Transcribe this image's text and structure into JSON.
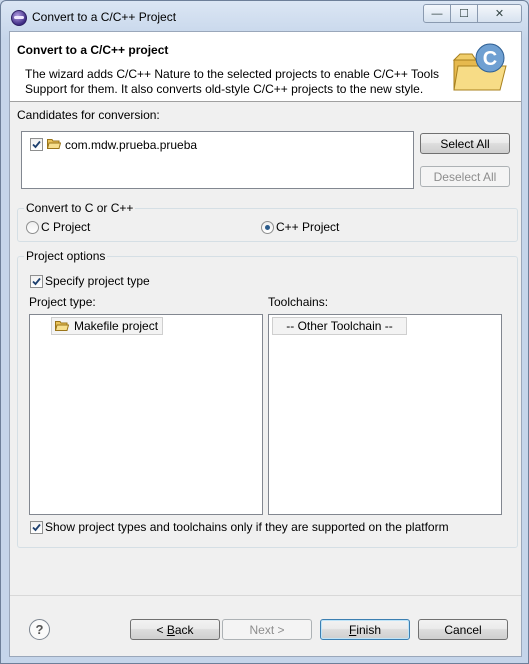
{
  "window": {
    "title": "Convert to a C/C++ Project",
    "controls": {
      "minimize": "—",
      "maximize": "☐",
      "close": "✕"
    }
  },
  "header": {
    "title": "Convert to a C/C++ project",
    "description": "The wizard adds C/C++ Nature to the selected projects to enable C/C++ Tools Support for them. It also converts old-style C/C++ projects to the new style."
  },
  "candidates": {
    "label": "Candidates for conversion:",
    "items": [
      {
        "label": "com.mdw.prueba.prueba",
        "checked": true
      }
    ],
    "select_all": "Select All",
    "deselect_all": "Deselect All"
  },
  "convert": {
    "group_title": "Convert to C or C++",
    "options": [
      {
        "label": "C Project",
        "selected": false
      },
      {
        "label": "C++ Project",
        "selected": true
      }
    ]
  },
  "project_options": {
    "group_title": "Project options",
    "specify_type": {
      "label": "Specify project type",
      "checked": true
    },
    "project_type_label": "Project type:",
    "project_types": [
      "Makefile project"
    ],
    "toolchains_label": "Toolchains:",
    "toolchains": [
      "-- Other Toolchain --"
    ],
    "show_supported": {
      "label": "Show project types and toolchains only if they are supported on the platform",
      "checked": true
    }
  },
  "footer": {
    "help": "?",
    "back": {
      "prefix": "< ",
      "mnemonic": "B",
      "rest": "ack"
    },
    "next": "Next >",
    "finish": {
      "mnemonic": "F",
      "rest": "inish"
    },
    "cancel": "Cancel"
  }
}
